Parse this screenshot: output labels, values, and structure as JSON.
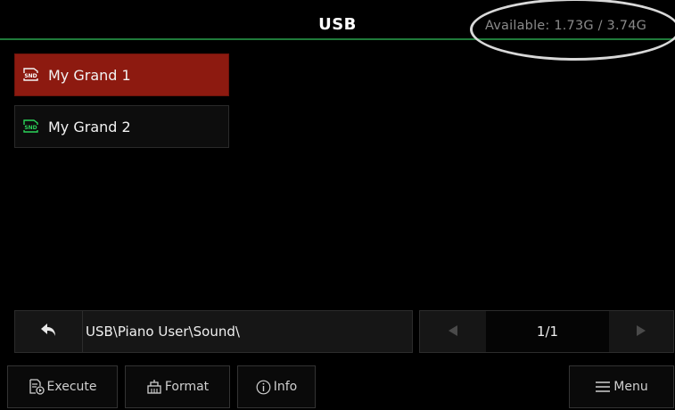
{
  "header": {
    "title": "USB",
    "available": "Available: 1.73G / 3.74G"
  },
  "files": [
    {
      "label": "My Grand 1",
      "icon": "snd-file-icon",
      "selected": true
    },
    {
      "label": "My Grand 2",
      "icon": "snd-file-icon",
      "selected": false
    }
  ],
  "path": {
    "text": "USB\\Piano User\\Sound\\"
  },
  "pager": {
    "page": "1/1"
  },
  "actions": {
    "execute": "Execute",
    "format": "Format",
    "info": "Info",
    "menu": "Menu"
  },
  "colors": {
    "selected": "#8d1a10",
    "header_line": "#1f7a3a",
    "icon_green": "#2bd35a"
  }
}
